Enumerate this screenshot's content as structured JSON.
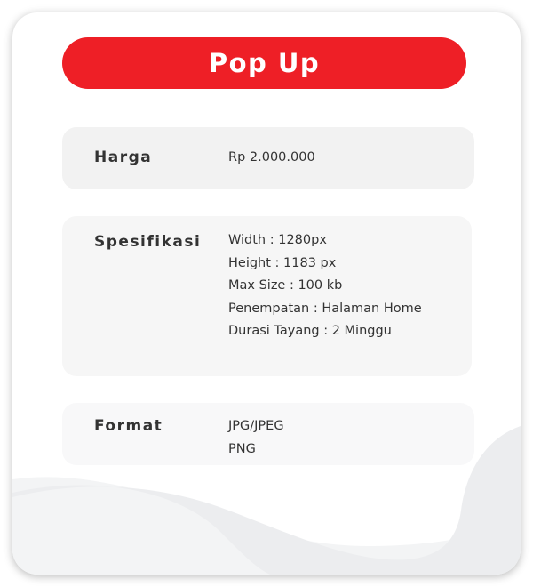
{
  "title": "Pop Up",
  "colors": {
    "accent": "#ee1f26",
    "box_bg": "#f3f3f3",
    "text": "#333333"
  },
  "rows": [
    {
      "label": "Harga",
      "values": [
        "Rp 2.000.000"
      ]
    },
    {
      "label": "Spesifikasi",
      "values": [
        "Width : 1280px",
        "Height : 1183 px",
        "Max Size : 100 kb",
        "Penempatan : Halaman Home",
        "Durasi Tayang : 2 Minggu"
      ]
    },
    {
      "label": "Format",
      "values": [
        "JPG/JPEG",
        "PNG"
      ]
    }
  ]
}
